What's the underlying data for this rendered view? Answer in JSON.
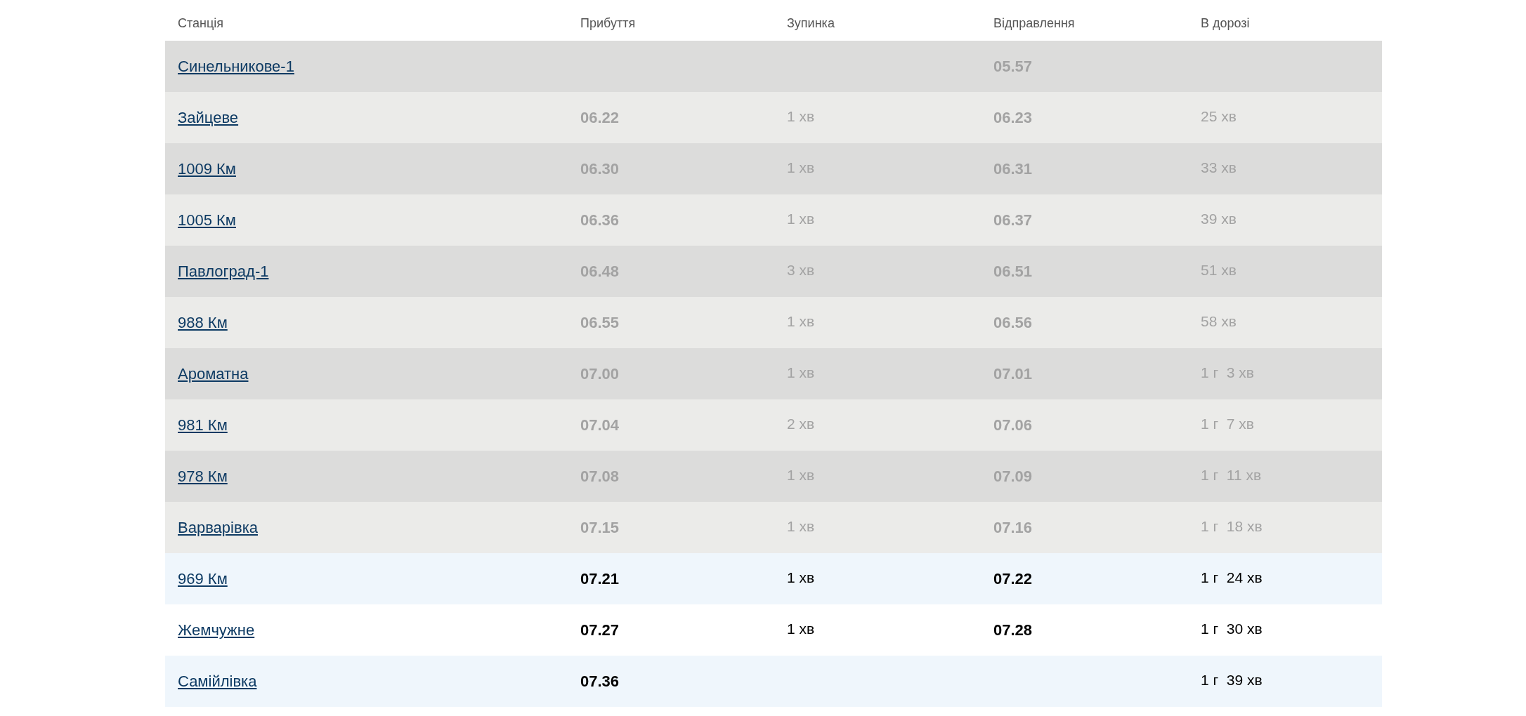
{
  "table": {
    "columns": [
      "Станція",
      "Прибуття",
      "Зупинка",
      "Відправлення",
      "В дорозі"
    ],
    "rows": [
      {
        "station": "Синельникове-1",
        "arrival": "",
        "stop": "",
        "departure": "05.57",
        "travel": "",
        "passed": true
      },
      {
        "station": "Зайцеве",
        "arrival": "06.22",
        "stop": "1 хв",
        "departure": "06.23",
        "travel": "25 хв",
        "passed": true
      },
      {
        "station": "1009 Км",
        "arrival": "06.30",
        "stop": "1 хв",
        "departure": "06.31",
        "travel": "33 хв",
        "passed": true
      },
      {
        "station": "1005 Км",
        "arrival": "06.36",
        "stop": "1 хв",
        "departure": "06.37",
        "travel": "39 хв",
        "passed": true
      },
      {
        "station": "Павлоград-1",
        "arrival": "06.48",
        "stop": "3 хв",
        "departure": "06.51",
        "travel": "51 хв",
        "passed": true
      },
      {
        "station": "988 Км",
        "arrival": "06.55",
        "stop": "1 хв",
        "departure": "06.56",
        "travel": "58 хв",
        "passed": true
      },
      {
        "station": "Ароматна",
        "arrival": "07.00",
        "stop": "1 хв",
        "departure": "07.01",
        "travel": "1 г  3 хв",
        "passed": true
      },
      {
        "station": "981 Км",
        "arrival": "07.04",
        "stop": "2 хв",
        "departure": "07.06",
        "travel": "1 г  7 хв",
        "passed": true
      },
      {
        "station": "978 Км",
        "arrival": "07.08",
        "stop": "1 хв",
        "departure": "07.09",
        "travel": "1 г  11 хв",
        "passed": true
      },
      {
        "station": "Варварівка",
        "arrival": "07.15",
        "stop": "1 хв",
        "departure": "07.16",
        "travel": "1 г  18 хв",
        "passed": true
      },
      {
        "station": "969 Км",
        "arrival": "07.21",
        "stop": "1 хв",
        "departure": "07.22",
        "travel": "1 г  24 хв",
        "passed": false
      },
      {
        "station": "Жемчужне",
        "arrival": "07.27",
        "stop": "1 хв",
        "departure": "07.28",
        "travel": "1 г  30 хв",
        "passed": false
      },
      {
        "station": "Самійлівка",
        "arrival": "07.36",
        "stop": "",
        "departure": "",
        "travel": "1 г  39 хв",
        "passed": false
      }
    ]
  }
}
